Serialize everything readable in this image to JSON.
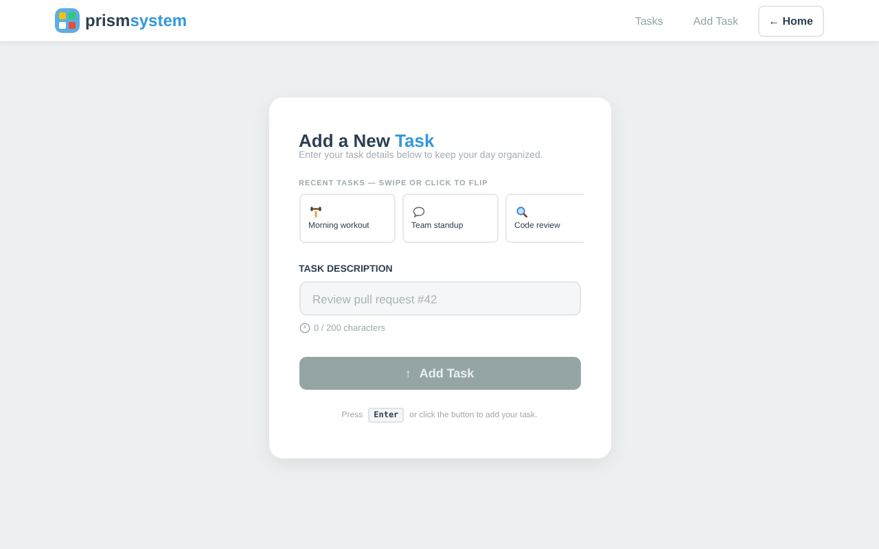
{
  "header": {
    "brand": {
      "prefix": "prism",
      "suffix": "system"
    },
    "nav": [
      {
        "label": "Tasks",
        "kind": "link"
      },
      {
        "label": "Add Task",
        "kind": "link"
      },
      {
        "label": "← Home",
        "kind": "button"
      }
    ]
  },
  "card": {
    "title": {
      "text": "Add a New",
      "highlight": "Task"
    },
    "subtitle": "Enter your task details below to keep your day organized.",
    "recent_label": "RECENT TASKS — SWIPE OR CLICK TO FLIP",
    "recent": [
      {
        "label": "Morning workout",
        "kind": "workout"
      },
      {
        "label": "Team standup",
        "kind": "chat"
      },
      {
        "label": "Code review",
        "kind": "search"
      }
    ],
    "field_label": "TASK DESCRIPTION",
    "field": {
      "placeholder": "Review pull request #42"
    },
    "counter": "0 / 200 characters",
    "submit": {
      "icon": "↑",
      "label": "Add Task",
      "disabled": true
    },
    "hint": {
      "before": "Press",
      "key": "Enter",
      "after": "or click the button to add your task."
    }
  }
}
